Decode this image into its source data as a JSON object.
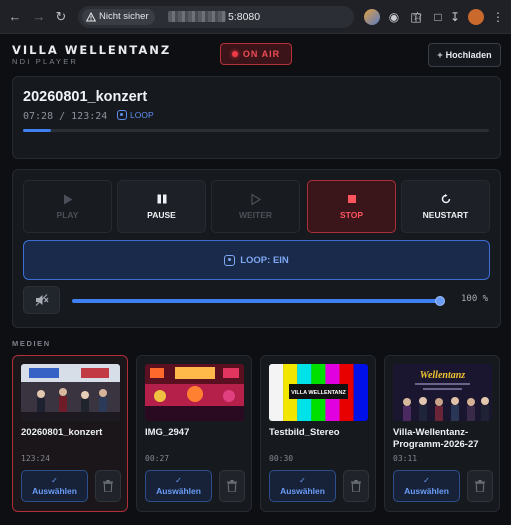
{
  "browser": {
    "security_label": "Nicht sicher",
    "url": "5:8080"
  },
  "header": {
    "brand": "VILLA WELLENTANZ",
    "subtitle": "NDI PLAYER",
    "on_air": "ON AIR",
    "upload": "Hochladen"
  },
  "now_playing": {
    "title": "20260801_konzert",
    "time": "07:28 / 123:24",
    "loop_label": "LOOP",
    "progress": 0.06
  },
  "controls": {
    "buttons": [
      {
        "label": "PLAY",
        "icon": "play-icon",
        "state": "disabled"
      },
      {
        "label": "PAUSE",
        "icon": "pause-icon",
        "state": "normal"
      },
      {
        "label": "WEITER",
        "icon": "next-icon",
        "state": "disabled"
      },
      {
        "label": "STOP",
        "icon": "stop-icon",
        "state": "active"
      },
      {
        "label": "NEUSTART",
        "icon": "restart-icon",
        "state": "normal"
      }
    ],
    "loop_toggle": "LOOP: EIN",
    "volume_percent": 100,
    "volume_label": "100 %"
  },
  "media": {
    "heading": "MEDIEN",
    "select_label": "Auswählen",
    "items": [
      {
        "name": "20260801_konzert",
        "duration": "123:24",
        "active": true
      },
      {
        "name": "IMG_2947",
        "duration": "00:27",
        "active": false
      },
      {
        "name": "Testbild_Stereo",
        "duration": "00:30",
        "active": false,
        "thumb_text": "VILLA WELLENTANZ"
      },
      {
        "name": "Villa-Wellentanz-Programm-2026-27",
        "duration": "03:11",
        "active": false,
        "thumb_text": "Wellentanz"
      }
    ]
  },
  "colors": {
    "accent": "#3e7ff2",
    "danger": "#ef4b55",
    "background": "#0d0f13",
    "card": "#16191e"
  }
}
